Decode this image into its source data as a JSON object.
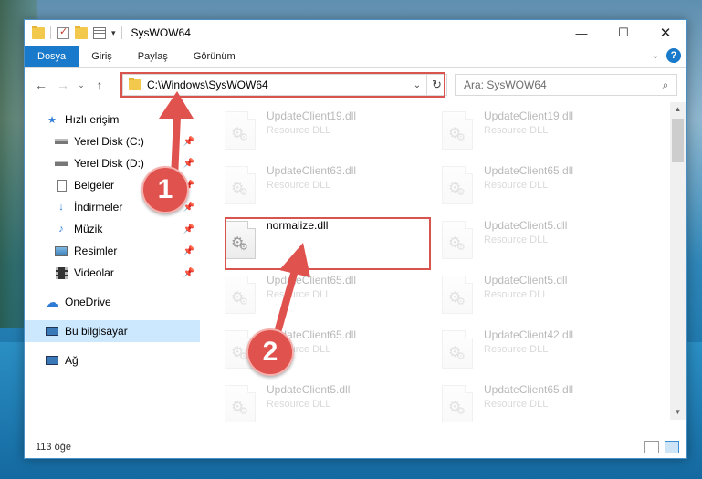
{
  "window": {
    "title": "SysWOW64",
    "controls": {
      "minimize": "—",
      "maximize": "☐",
      "close": "✕"
    }
  },
  "ribbon": {
    "tabs": [
      "Dosya",
      "Giriş",
      "Paylaş",
      "Görünüm"
    ],
    "help": "?"
  },
  "navigation": {
    "back": "←",
    "forward": "→",
    "recent": "⌄",
    "up": "↑",
    "address": "C:\\Windows\\SysWOW64",
    "refresh": "↻",
    "search_placeholder": "Ara: SysWOW64"
  },
  "sidebar": {
    "items": [
      {
        "label": "Hızlı erişim",
        "icon": "star-icon",
        "pinned": false
      },
      {
        "label": "Yerel Disk (C:)",
        "icon": "drive-icon",
        "pinned": true
      },
      {
        "label": "Yerel Disk (D:)",
        "icon": "drive-icon",
        "pinned": true
      },
      {
        "label": "Belgeler",
        "icon": "documents-icon",
        "pinned": true
      },
      {
        "label": "İndirmeler",
        "icon": "download-icon",
        "pinned": true
      },
      {
        "label": "Müzik",
        "icon": "music-icon",
        "pinned": true
      },
      {
        "label": "Resimler",
        "icon": "pictures-icon",
        "pinned": true
      },
      {
        "label": "Videolar",
        "icon": "video-icon",
        "pinned": true
      },
      {
        "label": "OneDrive",
        "icon": "cloud-icon",
        "pinned": false
      },
      {
        "label": "Bu bilgisayar",
        "icon": "computer-icon",
        "pinned": false,
        "selected": true
      },
      {
        "label": "Ağ",
        "icon": "network-icon",
        "pinned": false
      }
    ]
  },
  "files": {
    "left_column": [
      {
        "name": "UpdateClient19.dll",
        "type": "Resource DLL",
        "faded": true
      },
      {
        "name": "UpdateClient63.dll",
        "type": "Resource DLL",
        "faded": true
      },
      {
        "name": "normalize.dll",
        "type": "",
        "faded": false,
        "highlighted": true
      },
      {
        "name": "UpdateClient65.dll",
        "type": "Resource DLL",
        "faded": true
      },
      {
        "name": "UpdateClient65.dll",
        "type": "Resource DLL",
        "faded": true
      },
      {
        "name": "UpdateClient5.dll",
        "type": "Resource DLL",
        "faded": true
      }
    ],
    "right_column": [
      {
        "name": "UpdateClient19.dll",
        "type": "Resource DLL",
        "faded": true
      },
      {
        "name": "UpdateClient65.dll",
        "type": "Resource DLL",
        "faded": true
      },
      {
        "name": "UpdateClient5.dll",
        "type": "Resource DLL",
        "faded": true
      },
      {
        "name": "UpdateClient5.dll",
        "type": "Resource DLL",
        "faded": true
      },
      {
        "name": "UpdateClient42.dll",
        "type": "Resource DLL",
        "faded": true
      },
      {
        "name": "UpdateClient65.dll",
        "type": "Resource DLL",
        "faded": true
      }
    ]
  },
  "status": {
    "item_count": "113 öğe"
  },
  "annotations": {
    "step1": "1",
    "step2": "2",
    "color": "#e0524e"
  }
}
